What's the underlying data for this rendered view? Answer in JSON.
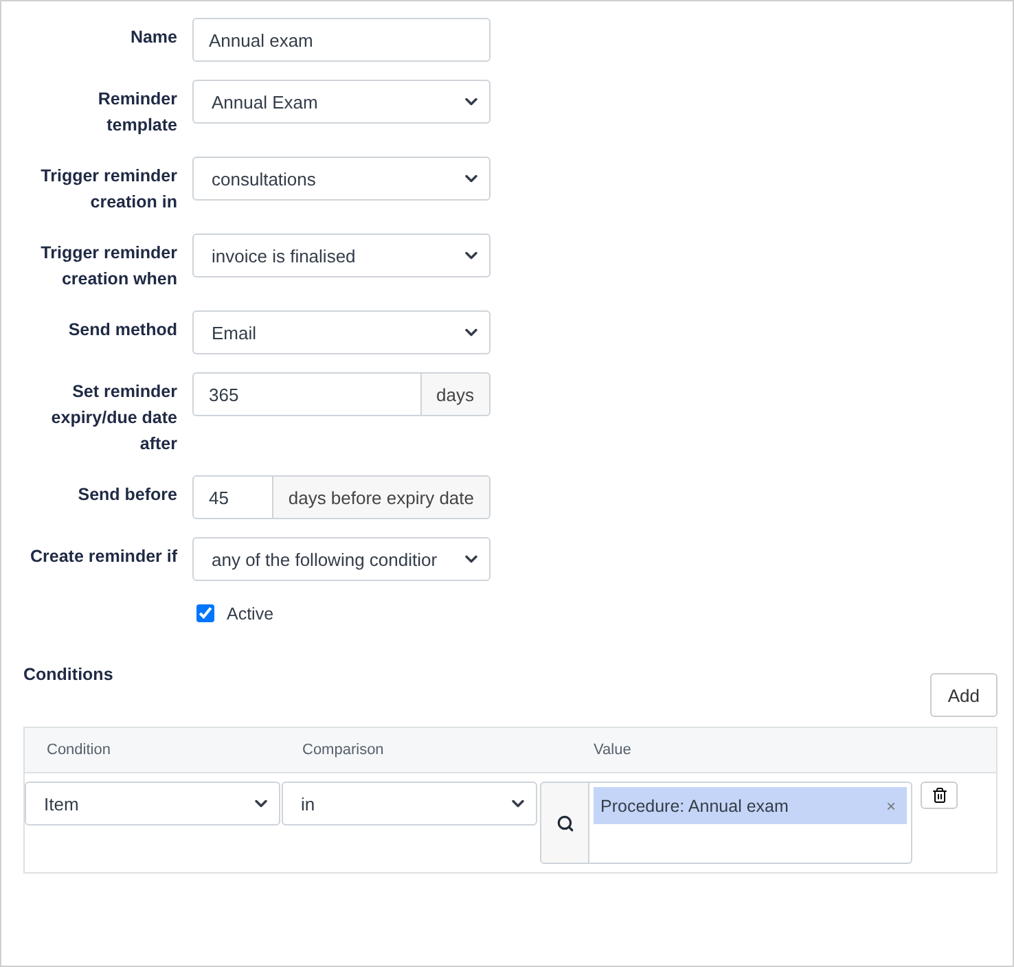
{
  "fields": [
    {
      "label": "Name",
      "kind": "text",
      "value": "Annual exam"
    },
    {
      "label": "Reminder template",
      "kind": "select",
      "value": "Annual Exam"
    },
    {
      "label": "Trigger reminder creation in",
      "kind": "select",
      "value": "consultations"
    },
    {
      "label": "Trigger reminder creation when",
      "kind": "select",
      "value": "invoice is finalised"
    },
    {
      "label": "Send method",
      "kind": "select",
      "value": "Email"
    },
    {
      "label": "Set reminder expiry/due date after",
      "kind": "addon",
      "value": "365",
      "addon": "days"
    },
    {
      "label": "Send before",
      "kind": "addon",
      "value": "45",
      "addon": "days before expiry date"
    },
    {
      "label": "Create reminder if",
      "kind": "select",
      "value": "any of the following conditior"
    }
  ],
  "active": {
    "label": "Active",
    "checked": true
  },
  "conditions": {
    "title": "Conditions",
    "add_button": "Add",
    "columns": [
      "Condition",
      "Comparison",
      "Value"
    ],
    "rows": [
      {
        "condition": "Item",
        "comparison": "in",
        "values": [
          "Procedure: Annual exam"
        ],
        "remove_tag": "×"
      }
    ]
  }
}
